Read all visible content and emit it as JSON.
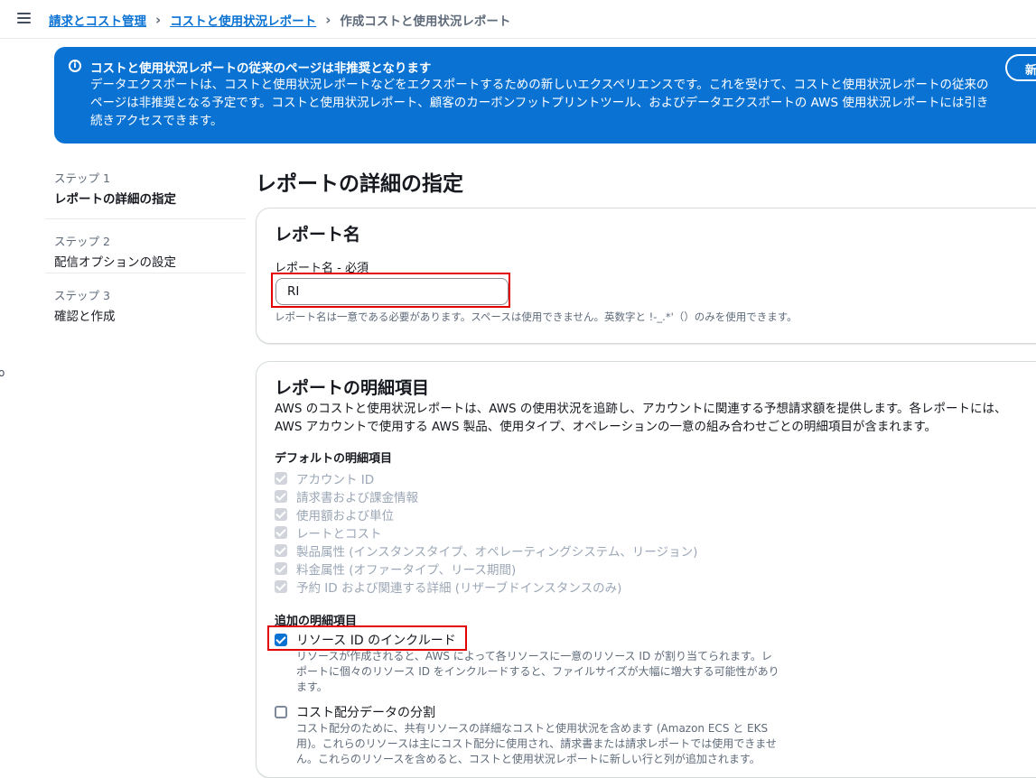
{
  "breadcrumb": {
    "items": [
      "請求とコスト管理",
      "コストと使用状況レポート"
    ],
    "current": "作成コストと使用状況レポート"
  },
  "flash": {
    "title": "コストと使用状況レポートの従来のページは非推奨となります",
    "body": "データエクスポートは、コストと使用状況レポートなどをエクスポートするための新しいエクスペリエンスです。これを受けて、コストと使用状況レポートの従来のページは非推奨となる予定です。コストと使用状況レポート、顧客のカーボンフットプリントツール、およびデータエクスポートの AWS 使用状況レポートには引き続きアクセスできます。",
    "button_label": "新",
    "color": "#0972d3"
  },
  "steps": [
    {
      "num": "ステップ 1",
      "label": "レポートの詳細の指定"
    },
    {
      "num": "ステップ 2",
      "label": "配信オプションの設定"
    },
    {
      "num": "ステップ 3",
      "label": "確認と作成"
    }
  ],
  "side_mark": "o",
  "page_title": "レポートの詳細の指定",
  "report_name": {
    "heading": "レポート名",
    "label": "レポート名 - 必須",
    "value": "RI",
    "hint": "レポート名は一意である必要があります。スペースは使用できません。英数字と !-_.*'（）のみを使用できます。"
  },
  "line_items": {
    "heading": "レポートの明細項目",
    "description": "AWS のコストと使用状況レポートは、AWS の使用状況を追跡し、アカウントに関連する予想請求額を提供します。各レポートには、AWS アカウントで使用する AWS 製品、使用タイプ、オペレーションの一意の組み合わせごとの明細項目が含まれます。",
    "default_heading": "デフォルトの明細項目",
    "default_items": [
      "アカウント ID",
      "請求書および課金情報",
      "使用額および単位",
      "レートとコスト",
      "製品属性 (インスタンスタイプ、オペレーティングシステム、リージョン)",
      "料金属性 (オファータイプ、リース期間)",
      "予約 ID および関連する詳細 (リザーブドインスタンスのみ)"
    ],
    "additional_heading": "追加の明細項目",
    "options": [
      {
        "label": "リソース ID のインクルード",
        "checked": true,
        "description": "リソースが作成されると、AWS によって各リソースに一意のリソース ID が割り当てられます。レポートに個々のリソース ID をインクルードすると、ファイルサイズが大幅に増大する可能性があります。"
      },
      {
        "label": "コスト配分データの分割",
        "checked": false,
        "description": "コスト配分のために、共有リソースの詳細なコストと使用状況を含めます (Amazon ECS と EKS 用)。これらのリソースは主にコスト配分に使用され、請求書または請求レポートでは使用できません。これらのリソースを含めると、コストと使用状況レポートに新しい行と列が追加されます。"
      }
    ]
  }
}
